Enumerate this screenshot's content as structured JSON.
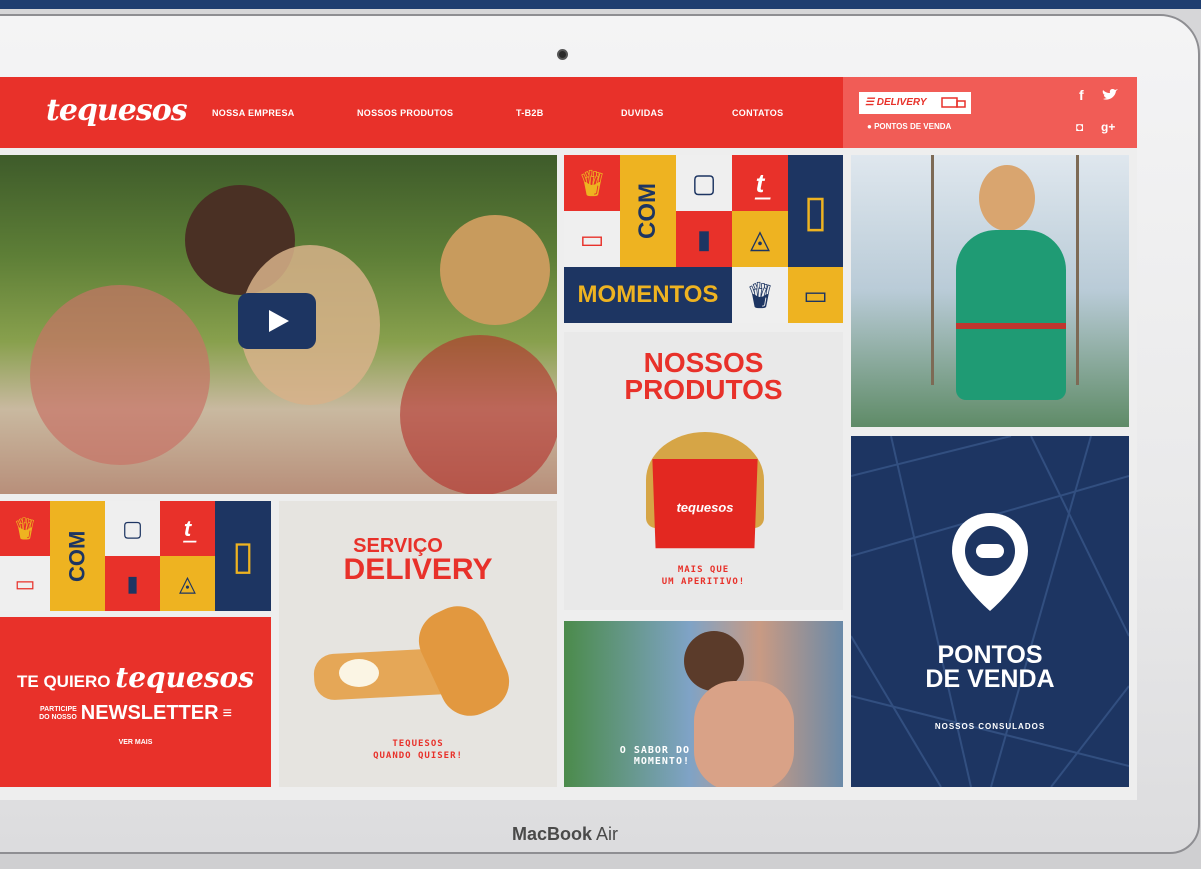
{
  "nav": {
    "logo": "tequesos",
    "items": [
      "NOSSA EMPRESA",
      "NOSSOS PRODUTOS",
      "T-B2B",
      "DUVIDAS",
      "CONTATOS"
    ],
    "delivery_label": "DELIVERY",
    "pontos_label": "PONTOS DE VENDA",
    "social": {
      "facebook": "f",
      "instagram": "◘",
      "google": "g+"
    }
  },
  "tiles": {
    "com": "COM",
    "momentos": "MOMENTOS",
    "produtos_title_1": "NOSSOS",
    "produtos_title_2": "PRODUTOS",
    "produtos_box_logo": "tequesos",
    "produtos_sub_1": "MAIS QUE",
    "produtos_sub_2": "UM APERITIVO!",
    "servico_title_1": "SERVIÇO",
    "servico_title_2": "DELIVERY",
    "servico_sub_1": "TEQUESOS",
    "servico_sub_2": "QUANDO QUISER!",
    "te_quiero": "TE QUIERO",
    "te_quiero_logo": "tequesos",
    "participe_1": "PARTICIPE",
    "participe_2": "DO NOSSO",
    "newsletter": "NEWSLETTER",
    "ver_mais": "VER MAIS",
    "pontos_title_1": "PONTOS",
    "pontos_title_2": "DE VENDA",
    "pontos_sub": "NOSSOS CONSULADOS",
    "sabor_1": "O SABOR DO",
    "sabor_2": "MOMENTO!"
  },
  "device": {
    "brand_bold": "MacBook",
    "brand_normal": " Air"
  },
  "colors": {
    "red": "#e8312a",
    "yellow": "#eeb321",
    "navy": "#1d3562"
  }
}
